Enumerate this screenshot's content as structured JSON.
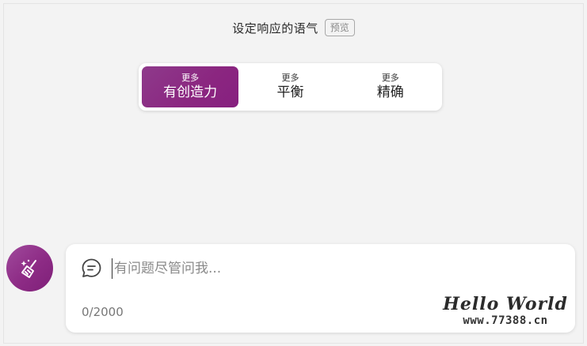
{
  "tone": {
    "title": "设定响应的语气",
    "preview_badge": "预览",
    "options": [
      {
        "sub": "更多",
        "main": "有创造力",
        "selected": true
      },
      {
        "sub": "更多",
        "main": "平衡",
        "selected": false
      },
      {
        "sub": "更多",
        "main": "精确",
        "selected": false
      }
    ]
  },
  "new_topic": {
    "icon": "broom-icon"
  },
  "chat": {
    "icon": "chat-bubble-icon",
    "placeholder": "有问题尽管问我...",
    "value": "",
    "counter": "0/2000"
  },
  "watermark": {
    "title": "Hello World",
    "url": "www.77388.cn"
  },
  "colors": {
    "accent_start": "#8e3a8b",
    "accent_end": "#86207f",
    "background": "#f3f3f3",
    "card": "#ffffff"
  }
}
